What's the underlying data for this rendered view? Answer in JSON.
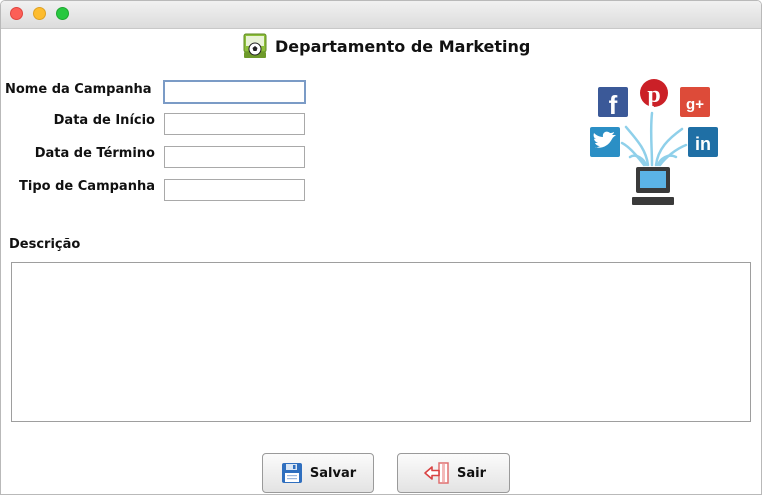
{
  "header": {
    "title": "Departamento de Marketing",
    "icon": "soccer-ball-screen-icon"
  },
  "form": {
    "nome_label": "Nome da Campanha",
    "nome_value": "",
    "inicio_label": "Data de Início",
    "inicio_value": "",
    "termino_label": "Data de Término",
    "termino_value": "",
    "tipo_label": "Tipo de Campanha",
    "tipo_value": "",
    "descricao_label": "Descrição",
    "descricao_value": ""
  },
  "social_icons": [
    "facebook-icon",
    "pinterest-icon",
    "google-plus-icon",
    "twitter-icon",
    "linkedin-icon",
    "computer-icon"
  ],
  "buttons": {
    "salvar_label": "Salvar",
    "sair_label": "Sair"
  },
  "colors": {
    "facebook": "#3b5998",
    "pinterest": "#cb2027",
    "google_plus": "#dd4b39",
    "twitter": "#2b8fc5",
    "linkedin": "#1f6fa5",
    "focus_border": "#7b9bc6"
  }
}
